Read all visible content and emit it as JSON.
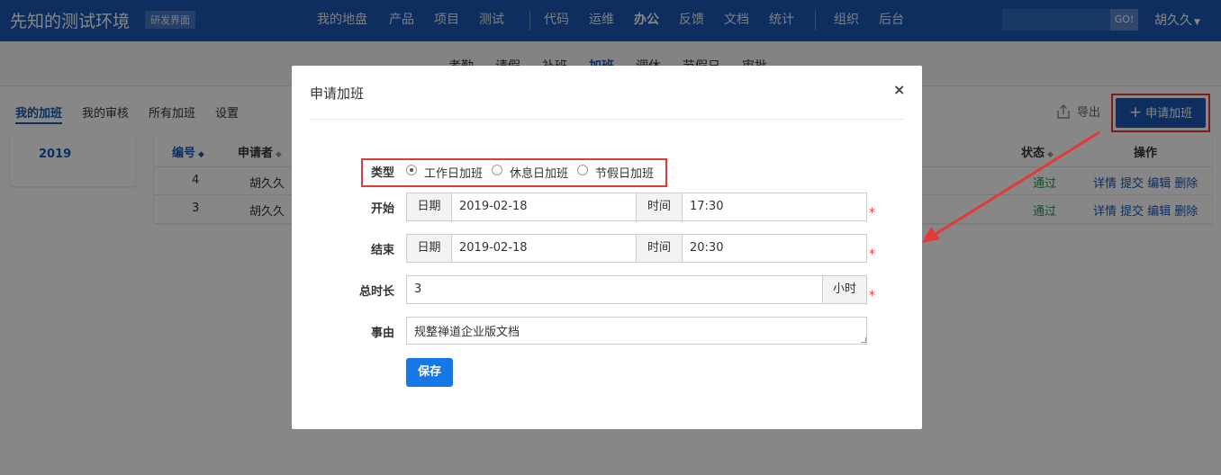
{
  "app": {
    "title": "先知的测试环境",
    "tag": "研发界面"
  },
  "nav": {
    "items": [
      "我的地盘",
      "产品",
      "项目",
      "测试",
      "代码",
      "运维",
      "办公",
      "反馈",
      "文档",
      "统计",
      "组织",
      "后台"
    ],
    "active": "办公",
    "go_label": "GO!",
    "user": "胡久久"
  },
  "subnav": {
    "items": [
      "考勤",
      "请假",
      "补班",
      "加班",
      "调休",
      "节假日",
      "审批"
    ],
    "active": "加班"
  },
  "page": {
    "tabs": [
      "我的加班",
      "我的审核",
      "所有加班",
      "设置"
    ],
    "active_tab": "我的加班",
    "export_label": "导出",
    "apply_label": "申请加班",
    "years": [
      "2019"
    ]
  },
  "table": {
    "columns": [
      "编号",
      "申请者",
      "状态",
      "操作"
    ],
    "rows": [
      {
        "id": "4",
        "applicant": "胡久久",
        "status": "通过",
        "actions": "详情 提交 编辑 删除"
      },
      {
        "id": "3",
        "applicant": "胡久久",
        "status": "通过",
        "actions": "详情 提交 编辑 删除"
      }
    ]
  },
  "modal": {
    "title": "申请加班",
    "close": "×",
    "type": {
      "label": "类型",
      "options": [
        "工作日加班",
        "休息日加班",
        "节假日加班"
      ],
      "selected": "工作日加班"
    },
    "start": {
      "label": "开始",
      "date_addon": "日期",
      "date": "2019-02-18",
      "time_addon": "时间",
      "time": "17:30"
    },
    "end": {
      "label": "结束",
      "date_addon": "日期",
      "date": "2019-02-18",
      "time_addon": "时间",
      "time": "20:30"
    },
    "duration": {
      "label": "总时长",
      "value": "3",
      "unit": "小时"
    },
    "reason": {
      "label": "事由",
      "value": "规整禅道企业版文档"
    },
    "required_mark": "*",
    "save_label": "保存"
  },
  "colors": {
    "brand": "#1a58b2",
    "highlight": "#e53935",
    "primary_button": "#1677e6",
    "status_pass": "#229954"
  }
}
